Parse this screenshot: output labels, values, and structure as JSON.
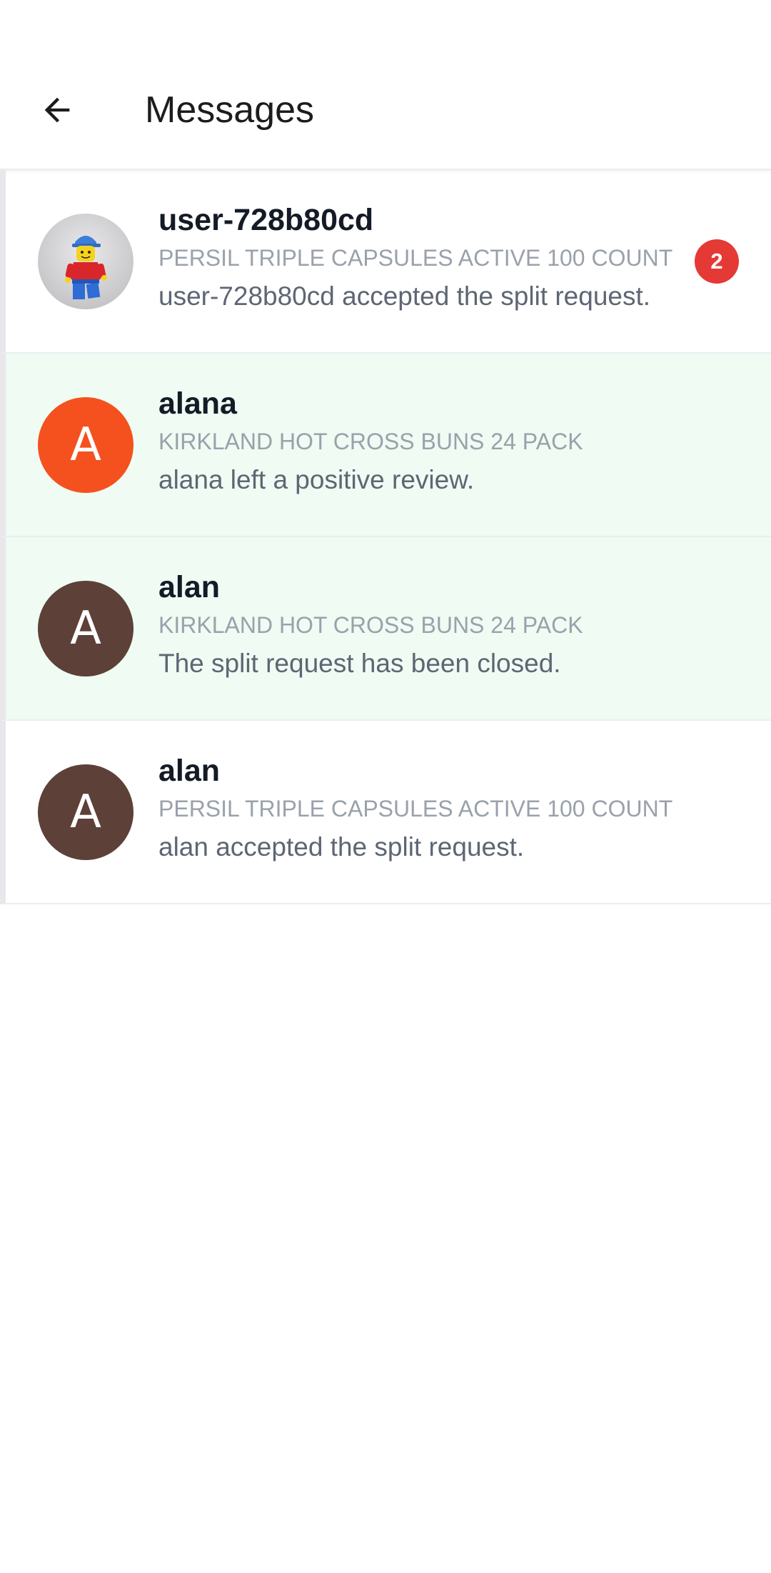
{
  "header": {
    "title": "Messages",
    "back_icon": "arrow-left-icon"
  },
  "colors": {
    "highlight_bg": "#effbf3",
    "badge": "#e53935"
  },
  "conversations": [
    {
      "name": "user-728b80cd",
      "avatar_type": "photo",
      "avatar_icon": "lego-minifigure-icon",
      "product": "PERSIL TRIPLE CAPSULES ACTIVE 100 COUNT",
      "preview": "user-728b80cd accepted the split request.",
      "unread": "2",
      "highlight": false
    },
    {
      "name": "alana",
      "avatar_type": "initial",
      "avatar_initial": "A",
      "avatar_color": "#f4511e",
      "product": "KIRKLAND HOT CROSS BUNS 24 PACK",
      "preview": "alana left a positive review.",
      "highlight": true
    },
    {
      "name": "alan",
      "avatar_type": "initial",
      "avatar_initial": "A",
      "avatar_color": "#5d4037",
      "product": "KIRKLAND HOT CROSS BUNS 24 PACK",
      "preview": "The split request has been closed.",
      "highlight": true
    },
    {
      "name": "alan",
      "avatar_type": "initial",
      "avatar_initial": "A",
      "avatar_color": "#5d4037",
      "product": "PERSIL TRIPLE CAPSULES ACTIVE 100 COUNT",
      "preview": "alan accepted the split request.",
      "highlight": false
    }
  ]
}
